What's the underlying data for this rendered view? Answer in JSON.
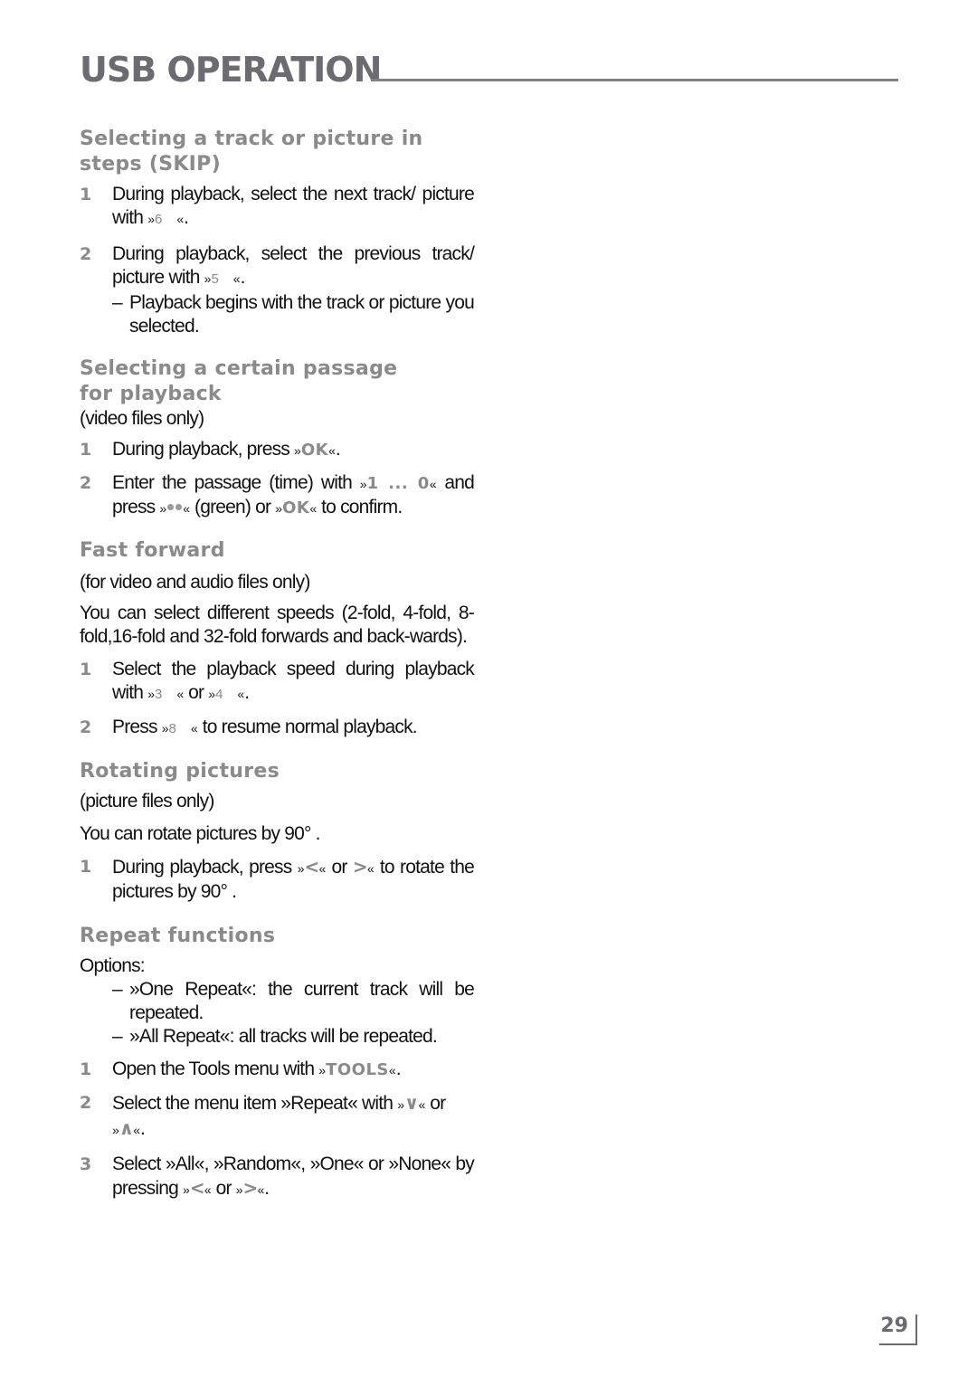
{
  "header": {
    "title": "USB OPERATION"
  },
  "sections": {
    "skip": {
      "title": "Selecting a track or picture in steps (SKIP)",
      "steps": [
        {
          "num": "1",
          "text_a": "During playback, select the next track/ picture with ",
          "key": "6",
          "text_b": "."
        },
        {
          "num": "2",
          "text_a": "During playback, select the previous track/ picture with ",
          "key": "5",
          "text_b": "."
        }
      ],
      "note": "Playback begins with the track or picture you selected."
    },
    "passage": {
      "title": "Selecting a certain passage for playback",
      "subtitle": "(video files only)",
      "step1": {
        "num": "1",
        "text_a": "During playback, press ",
        "key": "OK",
        "text_b": "."
      },
      "step2": {
        "num": "2",
        "text_a": "Enter the passage (time) with ",
        "key_range": "1 ... 0",
        "text_b": " and press ",
        "text_c": " (green) or ",
        "key_ok": "OK",
        "text_d": " to confirm."
      }
    },
    "fastforward": {
      "title": "Fast forward",
      "subtitle": "(for video and audio files only)",
      "body": "You can select different speeds (2-fold, 4-fold, 8-fold,16-fold and 32-fold forwards and back-wards).",
      "step1": {
        "num": "1",
        "text_a": "Select the playback speed during playback with ",
        "key_a": "3",
        "text_mid": " or ",
        "key_b": "4",
        "text_b": "."
      },
      "step2": {
        "num": "2",
        "text_a": "Press ",
        "key": "8",
        "text_b": " to resume normal playback."
      }
    },
    "rotate": {
      "title": "Rotating pictures",
      "subtitle": "(picture files only)",
      "body": "You can rotate pictures by 90° .",
      "step1": {
        "num": "1",
        "text_a": "During playback, press ",
        "text_mid": " or ",
        "text_b": " to rotate the pictures by 90° ."
      }
    },
    "repeat": {
      "title": "Repeat functions",
      "options_label": "Options:",
      "options": [
        "»One Repeat«: the current track will be repeated.",
        "»All Repeat«: all tracks will be repeated."
      ],
      "step1": {
        "num": "1",
        "text_a": "Open the Tools menu with ",
        "key": "TOOLS",
        "text_b": "."
      },
      "step2": {
        "num": "2",
        "text_a": "Select the menu item »Repeat« with ",
        "text_mid": " or ",
        "text_b": "."
      },
      "step3": {
        "num": "3",
        "text_a": "Select »All«, »Random«, »One« or »None« by pressing ",
        "text_mid": " or ",
        "text_b": "."
      }
    }
  },
  "footer": {
    "page_number": "29"
  },
  "colors": {
    "heading": "#8a8a8a",
    "title": "#6b6b70",
    "text": "#111111"
  }
}
